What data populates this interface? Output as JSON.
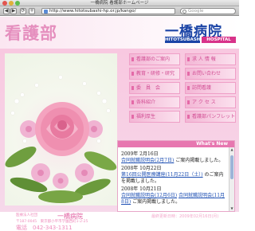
{
  "browser": {
    "title": "一橋病院 看護部ホームページ",
    "url": "http://www.hitotsubashi-hp.or.jp/kango/",
    "search_placeholder": "Google",
    "back_label": "◀",
    "forward_label": "▶",
    "reload_label": "⟳",
    "add_label": "+"
  },
  "header": {
    "department": "看護部",
    "hospital_name": "一橋病院",
    "hospital_en": "HITOTSUBASHI",
    "hospital_suffix": "HOSPITAL"
  },
  "menu": [
    {
      "label": "看護部のご案内"
    },
    {
      "label": "求 人 情 報"
    },
    {
      "label": "教育・研修・研究"
    },
    {
      "label": "お問い合わせ"
    },
    {
      "label": "委　員　会"
    },
    {
      "label": "訪問看護"
    },
    {
      "label": "各科紹介"
    },
    {
      "label": "ア ク セ ス"
    },
    {
      "label": "福利厚生"
    },
    {
      "label": "看護部パンフレット"
    }
  ],
  "news": {
    "heading": "What's New",
    "items": [
      {
        "date": "2009年 2月16日",
        "link": "合同就職説明会(2月7日)",
        "text": "ご案内掲載しました。"
      },
      {
        "date": "2008年 10月22日",
        "link": "第16回公開医療講座(11月22日（土）)",
        "text": "のご案内を掲載しました。"
      },
      {
        "date": "2008年 10月21日",
        "link": "合同就職説明会(12月6日)",
        "link2": "合同就職説明会(11月8日)",
        "text": "ご案内掲載しました。"
      }
    ]
  },
  "footer": {
    "small": "医療法人社団",
    "name": "一橋病院",
    "address": "〒187-0045　東京都小平市学園西町1-2-25",
    "phone": "電話　042-343-1311",
    "copyright": "最終更新日時：2009年02月16日(月)"
  },
  "colors": {
    "accent_pink": "#e777b0",
    "brand_blue": "#1b44a6",
    "background_pink": "#f8c8e0"
  }
}
